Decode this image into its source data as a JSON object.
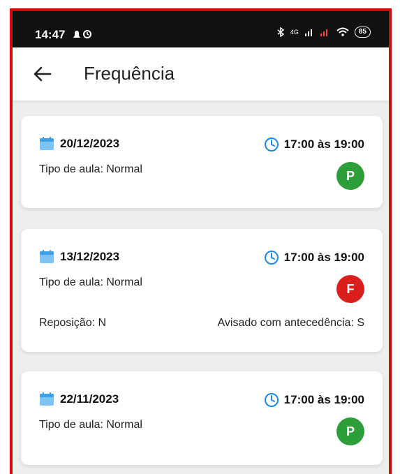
{
  "status_bar": {
    "time": "14:47",
    "battery": "85",
    "network": "4G"
  },
  "header": {
    "title": "Frequência"
  },
  "records": [
    {
      "date": "20/12/2023",
      "time": "17:00 às 19:00",
      "tipo": "Tipo de aula: Normal",
      "status": "P",
      "status_color": "#2e9e3a"
    },
    {
      "date": "13/12/2023",
      "time": "17:00 às 19:00",
      "tipo": "Tipo de aula: Normal",
      "status": "F",
      "status_color": "#d9201c",
      "reposicao": "Reposição: N",
      "avisado": "Avisado com antecedência: S"
    },
    {
      "date": "22/11/2023",
      "time": "17:00 às 19:00",
      "tipo": "Tipo de aula: Normal",
      "status": "P",
      "status_color": "#2e9e3a"
    }
  ],
  "colors": {
    "accent": "#1e88e5",
    "frame": "#d10a0a",
    "present": "#2e9e3a",
    "absent": "#d9201c"
  }
}
